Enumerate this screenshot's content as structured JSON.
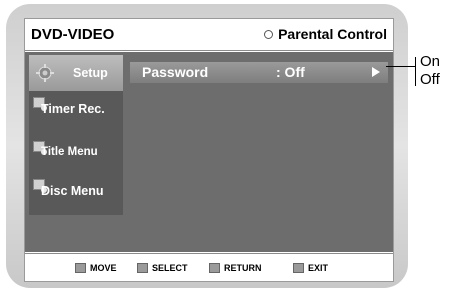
{
  "header": {
    "title": "DVD-VIDEO",
    "breadcrumb": "Parental Control",
    "breadcrumb_icon": "ring-icon"
  },
  "sidebar": {
    "items": [
      {
        "label": "Setup",
        "icon": "gear-icon",
        "active": true
      },
      {
        "label": "Timer Rec.",
        "icon": "timer-icon",
        "active": false
      },
      {
        "label": "Title Menu",
        "icon": "title-icon",
        "active": false
      },
      {
        "label": "Disc Menu",
        "icon": "disc-icon",
        "active": false
      }
    ]
  },
  "menu": {
    "row": {
      "key": "Password",
      "value": ": Off",
      "arrow": "arrow-right-icon"
    }
  },
  "footer": {
    "move": "MOVE",
    "select": "SELECT",
    "return": "RETURN",
    "exit": "EXIT"
  },
  "callout": {
    "on": "On",
    "off": "Off"
  },
  "colors": {
    "body_bg": "#6d6d6d",
    "sidebar_bg": "#595959",
    "active_item": "#b0b0b0",
    "text_light": "#ffffff"
  }
}
